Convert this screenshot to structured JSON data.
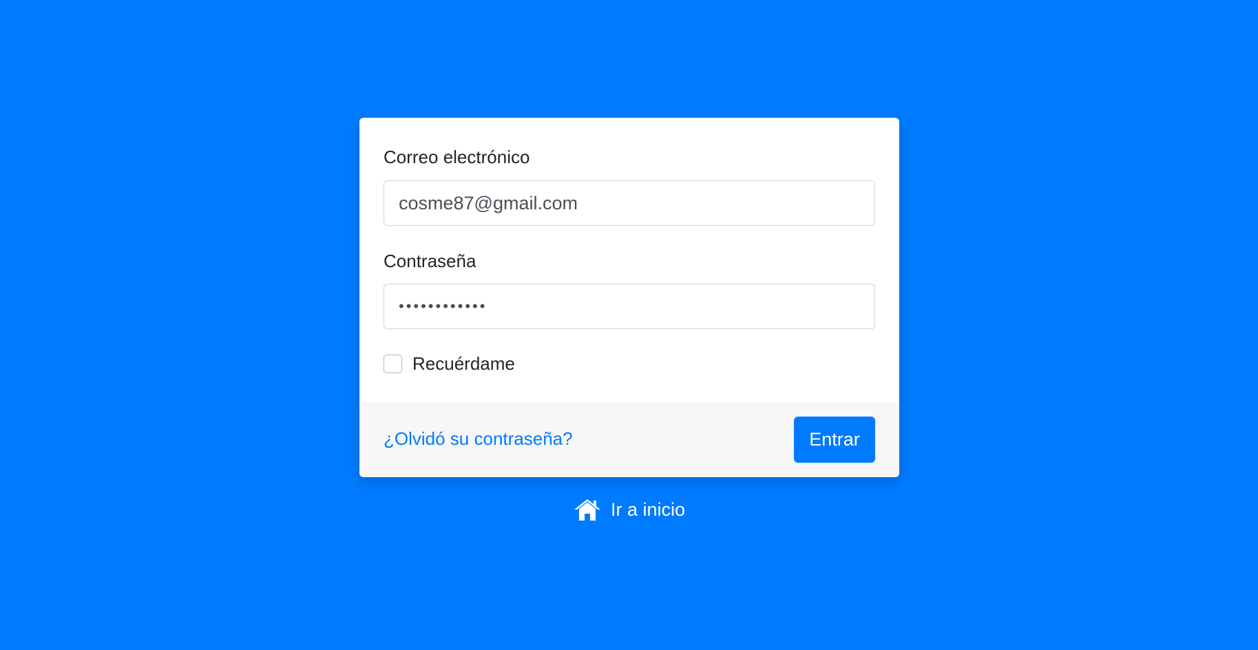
{
  "theme": {
    "background_color": "#007bff",
    "card_color": "#ffffff",
    "footer_color": "#f7f7f7",
    "primary_color": "#007bff"
  },
  "form": {
    "email_label": "Correo electrónico",
    "email_value": "cosme87@gmail.com",
    "password_label": "Contraseña",
    "password_value": "••••••••••••",
    "remember_label": "Recuérdame",
    "remember_checked": false
  },
  "footer": {
    "forgot_link": "¿Olvidó su contraseña?",
    "submit_label": "Entrar"
  },
  "home": {
    "icon": "home-icon",
    "label": "Ir a inicio"
  }
}
